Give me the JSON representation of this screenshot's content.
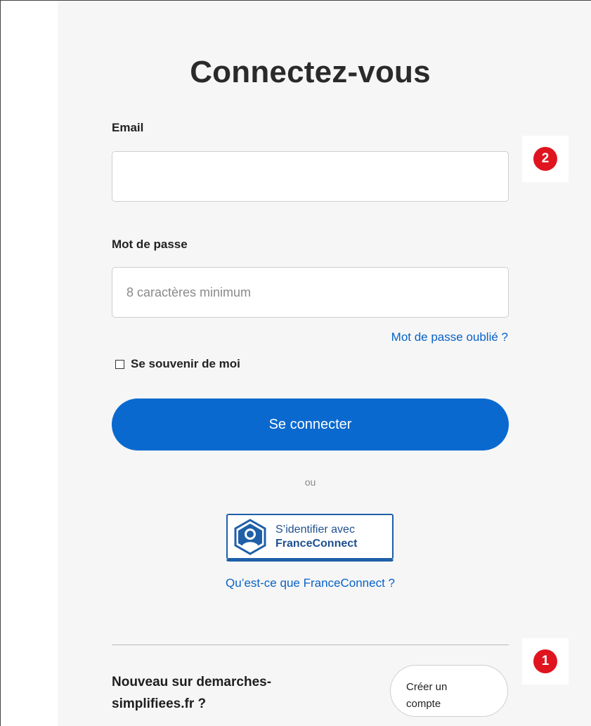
{
  "login": {
    "title": "Connectez-vous",
    "email_label": "Email",
    "email_value": "",
    "password_label": "Mot de passe",
    "password_placeholder": "8 caractères minimum",
    "forgot_password": "Mot de passe oublié ?",
    "remember_me": "Se souvenir de moi",
    "remember_checked": false,
    "submit_label": "Se connecter",
    "or_separator": "ou"
  },
  "franceconnect": {
    "button_line1": "S’identifier avec",
    "button_line2": "FranceConnect",
    "info_link": "Qu’est-ce que FranceConnect ?",
    "brand_color": "#1f5fa8"
  },
  "signup": {
    "prompt_line1": "Nouveau sur demarches-",
    "prompt_line2": "simplifiees.fr ?",
    "create_line1": "Créer un",
    "create_line2": "compte"
  },
  "annotations": {
    "badge_1": "1",
    "badge_2": "2",
    "badge_color": "#e0141e"
  },
  "colors": {
    "primary": "#0a69cf",
    "link": "#0762c8",
    "panel_background": "#f6f6f6"
  }
}
